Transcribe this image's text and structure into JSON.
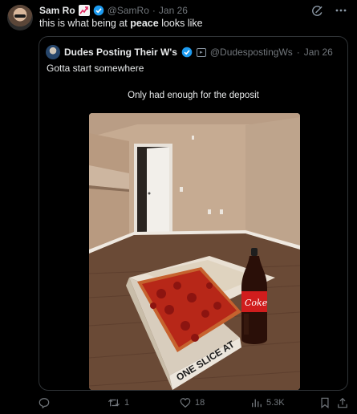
{
  "tweet": {
    "author_name": "Sam Ro",
    "author_handle": "@SamRo",
    "separator": "·",
    "date": "Jan 26",
    "text_before": "this is what being at ",
    "text_bold": "peace",
    "text_after": " looks like"
  },
  "quote": {
    "author_name": "Dudes Posting Their W's",
    "author_handle": "@DudespostingWs",
    "separator": "·",
    "date": "Jan 26",
    "text": "Gotta start somewhere",
    "media_caption": "Only had enough for the deposit",
    "photo_text": {
      "box_print": "ONE SLICE AT",
      "bottle_label": "Coke"
    }
  },
  "actions": {
    "reply_count": "",
    "retweet_count": "1",
    "like_count": "18",
    "views_count": "5.3K"
  },
  "icons": {
    "grok": "grok-icon",
    "more": "more-icon",
    "verified": "verified-badge-icon",
    "reply": "reply-icon",
    "retweet": "retweet-icon",
    "like": "heart-icon",
    "views": "views-icon",
    "bookmark": "bookmark-icon",
    "share": "share-icon"
  },
  "colors": {
    "background": "#000000",
    "text": "#e7e9ea",
    "muted": "#71767b",
    "border": "#2f3336",
    "verified": "#1d9bf0"
  }
}
